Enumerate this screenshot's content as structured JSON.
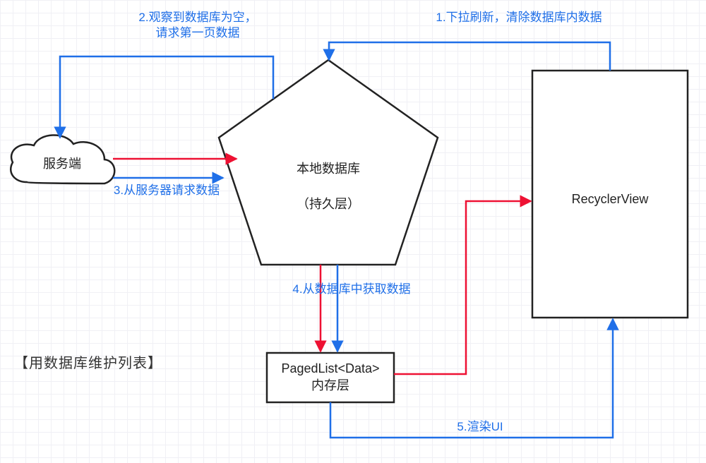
{
  "labels": {
    "step1": "1.下拉刷新，清除数据库内数据",
    "step2a": "2.观察到数据库为空，",
    "step2b": "请求第一页数据",
    "step3": "3.从服务器请求数据",
    "step4": "4.从数据库中获取数据",
    "step5": "5.渲染UI"
  },
  "nodes": {
    "server": "服务端",
    "db_line1": "本地数据库",
    "db_line2": "（持久层）",
    "paged_line1": "PagedList<Data>",
    "paged_line2": "内存层",
    "recycler": "RecyclerView"
  },
  "caption": "【用数据库维护列表】",
  "colors": {
    "blue": "#1f6fe8",
    "red": "#ee1133",
    "black": "#222222"
  }
}
